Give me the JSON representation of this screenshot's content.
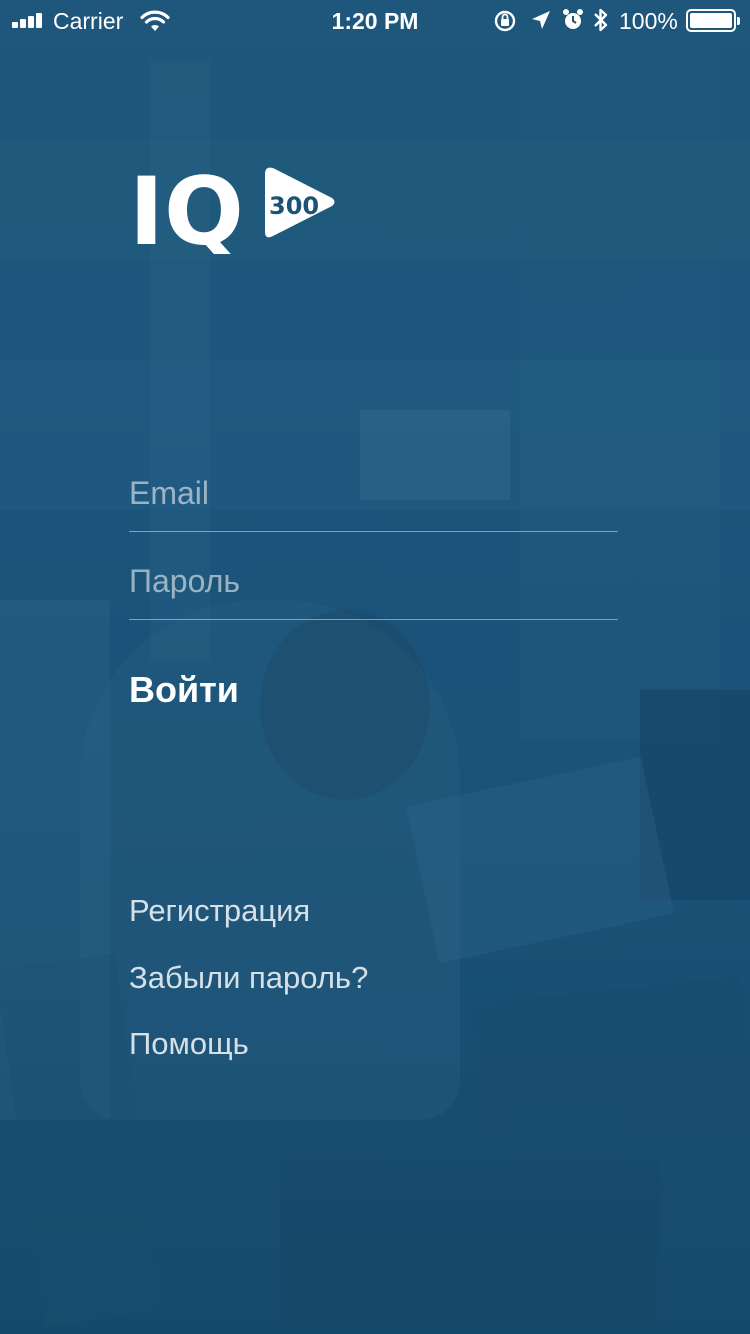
{
  "status_bar": {
    "carrier": "Carrier",
    "time": "1:20 PM",
    "battery": "100%"
  },
  "logo": {
    "letters": "IQ",
    "badge": "300"
  },
  "form": {
    "email_placeholder": "Email",
    "password_placeholder": "Пароль",
    "login_label": "Войти"
  },
  "links": {
    "register": "Регистрация",
    "forgot_password": "Забыли пароль?",
    "help": "Помощь"
  },
  "colors": {
    "background": "#1c5276",
    "text": "#ffffff"
  }
}
